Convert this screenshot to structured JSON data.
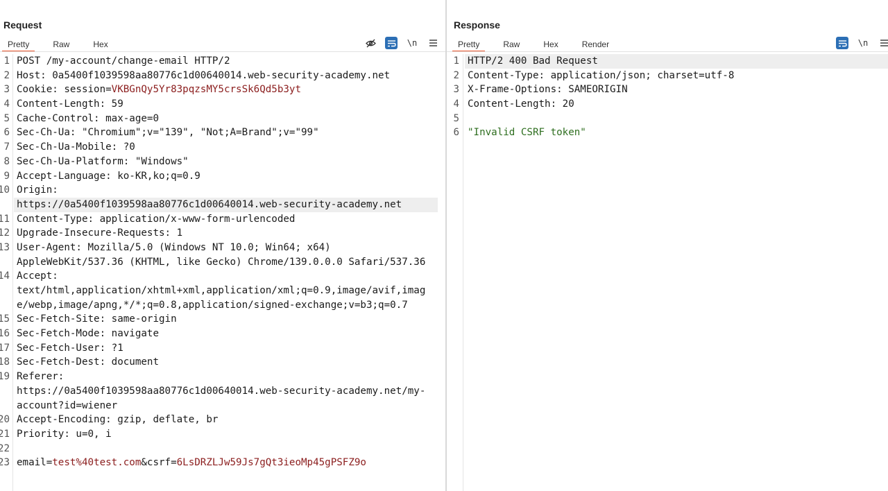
{
  "layout_controls": [
    "split-vertical-icon",
    "split-horizontal-icon",
    "tabs-icon"
  ],
  "request": {
    "title": "Request",
    "tabs": [
      {
        "label": "Pretty",
        "active": true
      },
      {
        "label": "Raw",
        "active": false
      },
      {
        "label": "Hex",
        "active": false
      }
    ],
    "toolbar": {
      "hide_icon": "eye-off-icon",
      "wrap_icon": "word-wrap-icon",
      "newline_label": "\\n",
      "menu_icon": "hamburger-menu-icon"
    },
    "lines": [
      {
        "num": "1",
        "parts": [
          {
            "t": "POST /my-account/change-email HTTP/2",
            "c": ""
          }
        ]
      },
      {
        "num": "2",
        "parts": [
          {
            "t": "Host: 0a5400f1039598aa80776c1d00640014.web-security-academy.net",
            "c": ""
          }
        ]
      },
      {
        "num": "3",
        "parts": [
          {
            "t": "Cookie: session=",
            "c": ""
          },
          {
            "t": "VKBGnQy5Yr83pqzsMY5crsSk6Qd5b3yt",
            "c": "red"
          }
        ]
      },
      {
        "num": "4",
        "parts": [
          {
            "t": "Content-Length: 59",
            "c": ""
          }
        ]
      },
      {
        "num": "5",
        "parts": [
          {
            "t": "Cache-Control: max-age=0",
            "c": ""
          }
        ]
      },
      {
        "num": "6",
        "parts": [
          {
            "t": "Sec-Ch-Ua: \"Chromium\";v=\"139\", \"Not;A=Brand\";v=\"99\"",
            "c": ""
          }
        ]
      },
      {
        "num": "7",
        "parts": [
          {
            "t": "Sec-Ch-Ua-Mobile: ?0",
            "c": ""
          }
        ]
      },
      {
        "num": "8",
        "parts": [
          {
            "t": "Sec-Ch-Ua-Platform: \"Windows\"",
            "c": ""
          }
        ]
      },
      {
        "num": "9",
        "parts": [
          {
            "t": "Accept-Language: ko-KR,ko;q=0.9",
            "c": ""
          }
        ]
      },
      {
        "num": "10",
        "parts": [
          {
            "t": "Origin:",
            "c": ""
          }
        ]
      },
      {
        "num": "",
        "hl": true,
        "parts": [
          {
            "t": "https://0a5400f1039598aa80776c1d00640014.web-security-academy.net",
            "c": ""
          }
        ]
      },
      {
        "num": "11",
        "parts": [
          {
            "t": "Content-Type: application/x-www-form-urlencoded",
            "c": ""
          }
        ]
      },
      {
        "num": "12",
        "parts": [
          {
            "t": "Upgrade-Insecure-Requests: 1",
            "c": ""
          }
        ]
      },
      {
        "num": "13",
        "parts": [
          {
            "t": "User-Agent: Mozilla/5.0 (Windows NT 10.0; Win64; x64)",
            "c": ""
          }
        ]
      },
      {
        "num": "",
        "parts": [
          {
            "t": "AppleWebKit/537.36 (KHTML, like Gecko) Chrome/139.0.0.0 Safari/537.36",
            "c": ""
          }
        ]
      },
      {
        "num": "14",
        "parts": [
          {
            "t": "Accept:",
            "c": ""
          }
        ]
      },
      {
        "num": "",
        "parts": [
          {
            "t": "text/html,application/xhtml+xml,application/xml;q=0.9,image/avif,imag",
            "c": ""
          }
        ]
      },
      {
        "num": "",
        "parts": [
          {
            "t": "e/webp,image/apng,*/*;q=0.8,application/signed-exchange;v=b3;q=0.7",
            "c": ""
          }
        ]
      },
      {
        "num": "15",
        "parts": [
          {
            "t": "Sec-Fetch-Site: same-origin",
            "c": ""
          }
        ]
      },
      {
        "num": "16",
        "parts": [
          {
            "t": "Sec-Fetch-Mode: navigate",
            "c": ""
          }
        ]
      },
      {
        "num": "17",
        "parts": [
          {
            "t": "Sec-Fetch-User: ?1",
            "c": ""
          }
        ]
      },
      {
        "num": "18",
        "parts": [
          {
            "t": "Sec-Fetch-Dest: document",
            "c": ""
          }
        ]
      },
      {
        "num": "19",
        "parts": [
          {
            "t": "Referer:",
            "c": ""
          }
        ]
      },
      {
        "num": "",
        "parts": [
          {
            "t": "https://0a5400f1039598aa80776c1d00640014.web-security-academy.net/my-",
            "c": ""
          }
        ]
      },
      {
        "num": "",
        "parts": [
          {
            "t": "account?id=wiener",
            "c": ""
          }
        ]
      },
      {
        "num": "20",
        "parts": [
          {
            "t": "Accept-Encoding: gzip, deflate, br",
            "c": ""
          }
        ]
      },
      {
        "num": "21",
        "parts": [
          {
            "t": "Priority: u=0, i",
            "c": ""
          }
        ]
      },
      {
        "num": "22",
        "parts": []
      },
      {
        "num": "23",
        "parts": [
          {
            "t": "email=",
            "c": ""
          },
          {
            "t": "test%40test.com",
            "c": "red"
          },
          {
            "t": "&csrf=",
            "c": ""
          },
          {
            "t": "6LsDRZLJw59Js7gQt3ieoMp45gPSFZ9o",
            "c": "red"
          }
        ]
      }
    ]
  },
  "response": {
    "title": "Response",
    "tabs": [
      {
        "label": "Pretty",
        "active": true
      },
      {
        "label": "Raw",
        "active": false
      },
      {
        "label": "Hex",
        "active": false
      },
      {
        "label": "Render",
        "active": false
      }
    ],
    "toolbar": {
      "wrap_icon": "word-wrap-icon",
      "newline_label": "\\n",
      "menu_icon": "hamburger-menu-icon"
    },
    "lines": [
      {
        "num": "1",
        "hl": true,
        "parts": [
          {
            "t": "HTTP/2 400 Bad Request",
            "c": ""
          }
        ]
      },
      {
        "num": "2",
        "parts": [
          {
            "t": "Content-Type: application/json; charset=utf-8",
            "c": ""
          }
        ]
      },
      {
        "num": "3",
        "parts": [
          {
            "t": "X-Frame-Options: SAMEORIGIN",
            "c": ""
          }
        ]
      },
      {
        "num": "4",
        "parts": [
          {
            "t": "Content-Length: 20",
            "c": ""
          }
        ]
      },
      {
        "num": "5",
        "parts": []
      },
      {
        "num": "6",
        "parts": [
          {
            "t": "\"Invalid CSRF token\"",
            "c": "grn"
          }
        ]
      }
    ]
  },
  "colors": {
    "accent": "#e8552b",
    "toggle_on": "#2c6fb5",
    "value_red": "#8b1d1d",
    "string_green": "#2e6e1f"
  }
}
